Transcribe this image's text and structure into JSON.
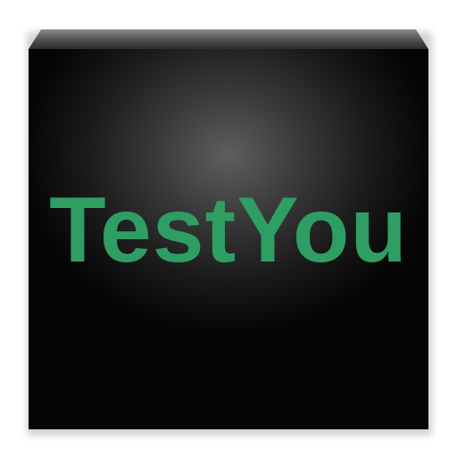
{
  "app_icon": {
    "app_name": "TestYou",
    "text_color": "#2e9e63",
    "face_color": "#1a1a1a"
  }
}
